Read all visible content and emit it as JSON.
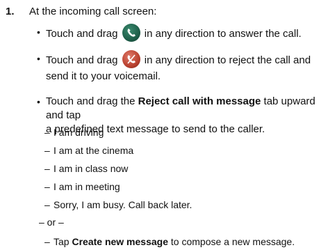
{
  "step": {
    "number": "1.",
    "text": "At the incoming call screen:"
  },
  "bullets": [
    {
      "marker": "•",
      "part1": "Touch and drag",
      "icon": "answer-call-icon",
      "part2": "in any direction to answer the call."
    },
    {
      "marker": "•",
      "part1": "Touch and drag",
      "icon": "reject-call-icon",
      "part2": "in any direction to reject the call and",
      "line2": "send it to your voicemail."
    },
    {
      "marker": "•",
      "part1": "Touch and drag the",
      "bold": "Reject call with message",
      "part2": "tab upward and tap",
      "line2": "a predefined text message to send to the caller."
    }
  ],
  "messages": [
    "I am driving",
    "I am at the cinema",
    "I am in class now",
    "I am in meeting",
    "Sorry, I am busy. Call back later."
  ],
  "dash": "–",
  "or_text": "– or –",
  "create": {
    "part1": "Tap",
    "bold": "Create new message",
    "part2": "to compose a new message."
  },
  "colors": {
    "answer_icon": "#1f5f4a",
    "reject_icon": "#b9412f",
    "text": "#111111"
  }
}
